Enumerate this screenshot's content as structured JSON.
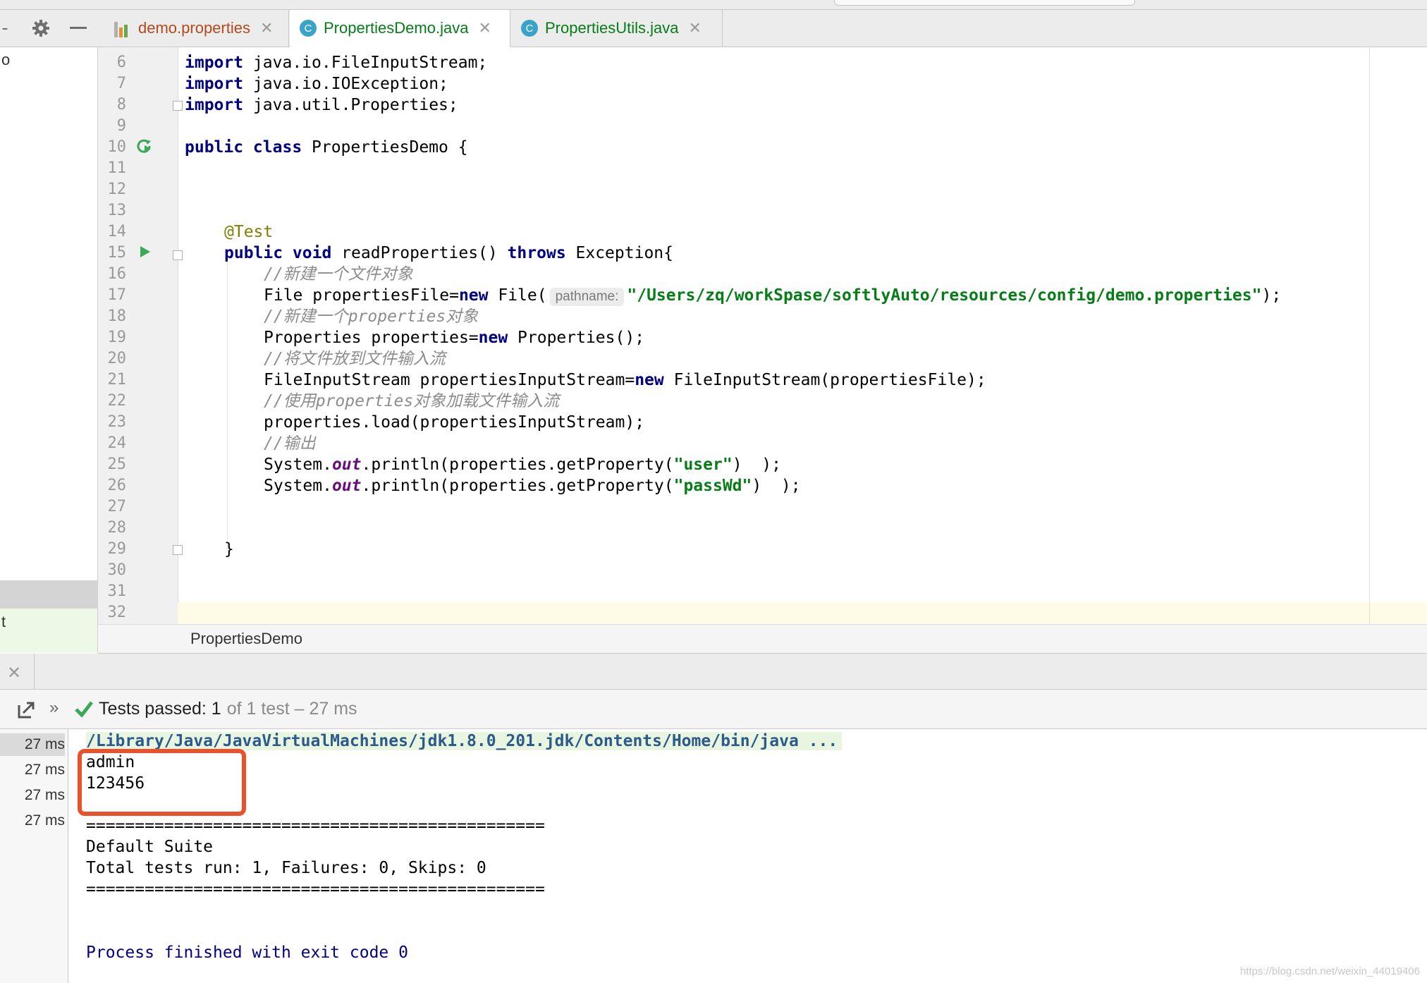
{
  "tabs": [
    {
      "label": "demo.properties",
      "type": "properties",
      "color": "#b44a1c"
    },
    {
      "label": "PropertiesDemo.java",
      "type": "class",
      "color": "#067d17"
    },
    {
      "label": "PropertiesUtils.java",
      "type": "class",
      "color": "#067d17"
    }
  ],
  "left_panel": {
    "top_stub": "o",
    "bottom_stub": "t"
  },
  "line_numbers": [
    "6",
    "7",
    "8",
    "9",
    "10",
    "11",
    "12",
    "13",
    "14",
    "15",
    "16",
    "17",
    "18",
    "19",
    "20",
    "21",
    "22",
    "23",
    "24",
    "25",
    "26",
    "27",
    "28",
    "29",
    "30",
    "31",
    "32"
  ],
  "code": {
    "l6_kw": "import",
    "l6_rest": " java.io.FileInputStream;",
    "l7_kw": "import",
    "l7_rest": " java.io.IOException;",
    "l8_kw": "import",
    "l8_rest": " java.util.Properties;",
    "l10_kw": "public class",
    "l10_rest": " PropertiesDemo {",
    "l14_ann": "@Test",
    "l15_kw1": "public void",
    "l15_mid": " readProperties() ",
    "l15_kw2": "throws",
    "l15_rest": " Exception{",
    "l16_cm": "//新建一个文件对象",
    "l17_a": "File propertiesFile=",
    "l17_kw": "new",
    "l17_b": " File(",
    "l17_hint": "pathname:",
    "l17_str": "\"/Users/zq/workSpase/softlyAuto/resources/config/demo.properties\"",
    "l17_c": ");",
    "l18_cm": "//新建一个properties对象",
    "l19_a": "Properties properties=",
    "l19_kw": "new",
    "l19_b": " Properties();",
    "l20_cm": "//将文件放到文件输入流",
    "l21_a": "FileInputStream propertiesInputStream=",
    "l21_kw": "new",
    "l21_b": " FileInputStream(propertiesFile);",
    "l22_cm": "//使用properties对象加载文件输入流",
    "l23": "properties.load(propertiesInputStream);",
    "l24_cm": "//输出",
    "l25_a": "System.",
    "l25_fld": "out",
    "l25_b": ".println(properties.getProperty(",
    "l25_str": "\"user\"",
    "l25_c": ")  );",
    "l26_a": "System.",
    "l26_fld": "out",
    "l26_b": ".println(properties.getProperty(",
    "l26_str": "\"passWd\"",
    "l26_c": ")  );",
    "l29": "}"
  },
  "breadcrumb": "PropertiesDemo",
  "run": {
    "status_main": "Tests passed: 1",
    "status_muted": "of 1 test – 27 ms",
    "times": [
      "27 ms",
      "27 ms",
      "27 ms",
      "27 ms"
    ],
    "output": {
      "cmd": "/Library/Java/JavaVirtualMachines/jdk1.8.0_201.jdk/Contents/Home/bin/java ...",
      "line1": "admin",
      "line2": "123456",
      "sep1": "===============================================",
      "suite": "Default Suite",
      "totals": "Total tests run: 1, Failures: 0, Skips: 0",
      "sep2": "===============================================",
      "finished": "Process finished with exit code 0"
    }
  },
  "watermark": "https://blog.csdn.net/weixin_44019406",
  "colors": {
    "success_green": "#3aa856",
    "highlight_red": "#e8532c",
    "class_icon": "#3aa3c9"
  }
}
